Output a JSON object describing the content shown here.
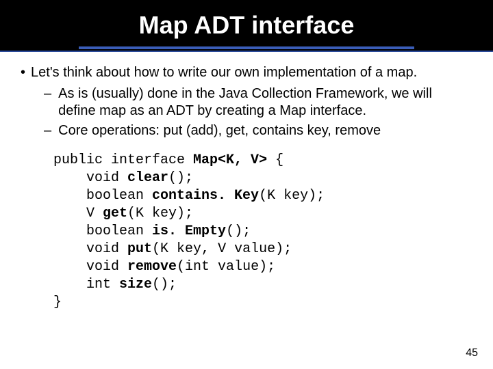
{
  "title": "Map ADT interface",
  "bullets": {
    "main": "Let's think about how to write our own implementation of a map.",
    "subs": [
      "As is (usually) done in the Java Collection Framework, we will define map as an ADT by creating a Map interface.",
      "Core operations: put (add), get, contains key, remove"
    ]
  },
  "code": {
    "line1_pre": "public interface ",
    "line1_bold": "Map<K, V>",
    "line1_post": " {",
    "line2_pre": "    void ",
    "line2_bold": "clear",
    "line2_post": "();",
    "line3_pre": "    boolean ",
    "line3_bold": "contains. Key",
    "line3_post": "(K key);",
    "line4_pre": "    V ",
    "line4_bold": "get",
    "line4_post": "(K key);",
    "line5_pre": "    boolean ",
    "line5_bold": "is. Empty",
    "line5_post": "();",
    "line6_pre": "    void ",
    "line6_bold": "put",
    "line6_post": "(K key, V value);",
    "line7_pre": "    void ",
    "line7_bold": "remove",
    "line7_post": "(int value);",
    "line8_pre": "    int ",
    "line8_bold": "size",
    "line8_post": "();",
    "line9": "}"
  },
  "page_number": "45"
}
